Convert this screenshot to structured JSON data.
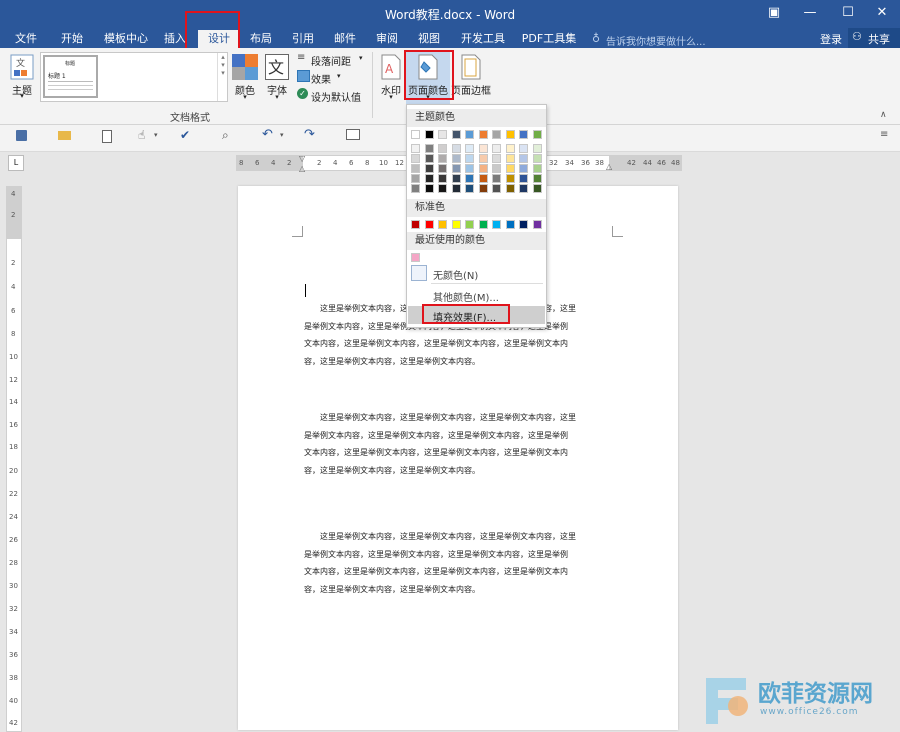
{
  "window": {
    "title": "Word教程.docx - Word",
    "controls": [
      "▣",
      "—",
      "☐",
      "✕"
    ]
  },
  "tabs": [
    {
      "label": "文件"
    },
    {
      "label": "开始"
    },
    {
      "label": "模板中心"
    },
    {
      "label": "插入"
    },
    {
      "label": "设计"
    },
    {
      "label": "布局"
    },
    {
      "label": "引用"
    },
    {
      "label": "邮件"
    },
    {
      "label": "审阅"
    },
    {
      "label": "视图"
    },
    {
      "label": "开发工具"
    },
    {
      "label": "PDF工具集"
    }
  ],
  "tell_me": "告诉我你想要做什么...",
  "login": "登录",
  "share": "共享",
  "ribbon": {
    "theme_label": "主题",
    "gallery_item_heading": "标题",
    "gallery_item_title": "标题 1",
    "colors_label": "颜色",
    "fonts_label": "字体",
    "paragraph_spacing": "段落间距",
    "effects": "效果",
    "set_default": "设为默认值",
    "group_label": "文档格式",
    "watermark_label": "水印",
    "page_color_label": "页面颜色",
    "page_borders_label": "页面边框"
  },
  "hruler_ticks": [
    "8",
    "6",
    "4",
    "2",
    "2",
    "4",
    "6",
    "8",
    "10",
    "12",
    "32",
    "34",
    "36",
    "38",
    "42",
    "44",
    "46",
    "48"
  ],
  "vruler_ticks": [
    "4",
    "2",
    "2",
    "4",
    "6",
    "8",
    "10",
    "12",
    "14",
    "16",
    "18",
    "20",
    "22",
    "24",
    "26",
    "28",
    "30",
    "32",
    "34",
    "36",
    "38",
    "40",
    "42"
  ],
  "menu": {
    "theme_colors_header": "主题颜色",
    "standard_colors_header": "标准色",
    "recent_colors_header": "最近使用的颜色",
    "no_color": "无颜色(N)",
    "more_colors": "其他颜色(M)...",
    "fill_effects": "填充效果(F)...",
    "theme_top_row": [
      "#ffffff",
      "#000000",
      "#e7e6e6",
      "#44546a",
      "#5b9bd5",
      "#ed7d31",
      "#a5a5a5",
      "#ffc000",
      "#4472c4",
      "#70ad47"
    ],
    "theme_shades": [
      [
        "#f2f2f2",
        "#7f7f7f",
        "#d0cece",
        "#d6dce4",
        "#deebf6",
        "#fbe5d5",
        "#ededed",
        "#fff2cc",
        "#dae3f3",
        "#e2efd9"
      ],
      [
        "#d8d8d8",
        "#595959",
        "#aeabab",
        "#adb9ca",
        "#bdd7ee",
        "#f7cbac",
        "#dbdbdb",
        "#fee599",
        "#b4c6e7",
        "#c5e0b3"
      ],
      [
        "#bfbfbf",
        "#3f3f3f",
        "#757070",
        "#8496b0",
        "#9cc3e5",
        "#f4b183",
        "#c9c9c9",
        "#ffd965",
        "#8eaadb",
        "#a8d08d"
      ],
      [
        "#a5a5a5",
        "#262626",
        "#3a3838",
        "#323f4f",
        "#2e75b5",
        "#c55a11",
        "#7b7b7b",
        "#bf9000",
        "#2f5496",
        "#538135"
      ],
      [
        "#7f7f7f",
        "#0c0c0c",
        "#171616",
        "#222a35",
        "#1e4e79",
        "#833c0b",
        "#525252",
        "#7f6000",
        "#1f3864",
        "#375623"
      ]
    ],
    "standard": [
      "#c00000",
      "#ff0000",
      "#ffc000",
      "#ffff00",
      "#92d050",
      "#00b050",
      "#00b0f0",
      "#0070c0",
      "#002060",
      "#7030a0"
    ],
    "recent": [
      "#f4a6c6"
    ]
  },
  "document": {
    "paragraphs": [
      [
        "这里是举例文本内容，这里是举例文本内容，这里是举例文本内容，这里",
        "是举例文本内容，这里是举例文本内容，这里是举例文本内容，这里是举例",
        "文本内容，这里是举例文本内容，这里是举例文本内容，这里是举例文本内",
        "容，这里是举例文本内容，这里是举例文本内容。"
      ],
      [
        "这里是举例文本内容，这里是举例文本内容，这里是举例文本内容，这里",
        "是举例文本内容，这里是举例文本内容，这里是举例文本内容，这里是举例",
        "文本内容，这里是举例文本内容，这里是举例文本内容，这里是举例文本内",
        "容，这里是举例文本内容，这里是举例文本内容。"
      ],
      [
        "这里是举例文本内容，这里是举例文本内容，这里是举例文本内容，这里",
        "是举例文本内容，这里是举例文本内容，这里是举例文本内容，这里是举例",
        "文本内容，这里是举例文本内容，这里是举例文本内容，这里是举例文本内",
        "容，这里是举例文本内容，这里是举例文本内容。"
      ]
    ]
  },
  "watermark": {
    "brand": "欧菲资源网",
    "url": "www.office26.com"
  },
  "colors": {
    "brand_blue": "#2b579a",
    "highlight_red": "#e0141c"
  }
}
